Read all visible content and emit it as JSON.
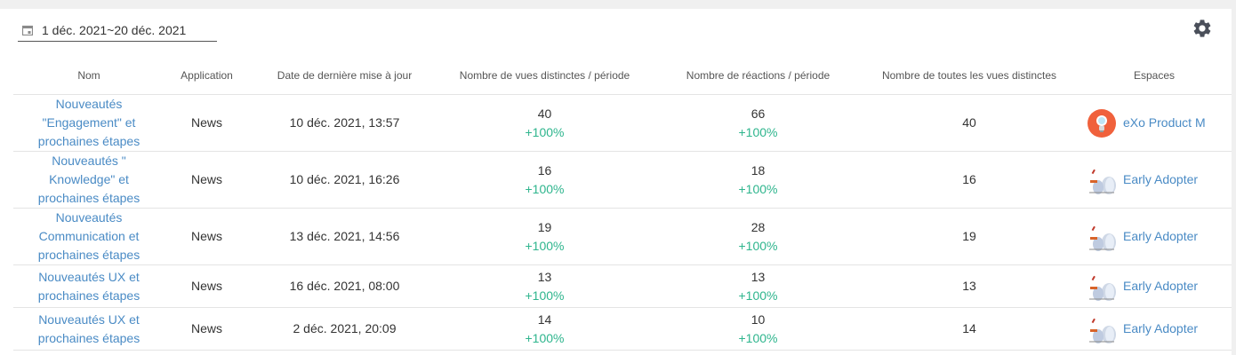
{
  "date_range": "1 déc. 2021~20 déc. 2021",
  "colors": {
    "link": "#4a8bc5",
    "positive": "#2eb58d",
    "avatar_orange": "#f0613c"
  },
  "icons": {
    "date": "calendar-icon",
    "settings": "gear-icon",
    "space_product": "lightbulb-avatar-icon",
    "space_early": "early-adopters-avatar-icon"
  },
  "columns": [
    "Nom",
    "Application",
    "Date de dernière mise à jour",
    "Nombre de vues distinctes / période",
    "Nombre de réactions / période",
    "Nombre de toutes les vues distinctes",
    "Espaces"
  ],
  "rows": [
    {
      "name": "Nouveautés \"Engagement\" et prochaines étapes",
      "app": "News",
      "updated": "10 déc. 2021, 13:57",
      "views": "40",
      "views_delta": "+100%",
      "reactions": "66",
      "reactions_delta": "+100%",
      "total_views": "40",
      "space": "eXo Product M",
      "space_icon": "lightbulb-avatar-icon"
    },
    {
      "name": "Nouveautés \" Knowledge\" et prochaines étapes",
      "app": "News",
      "updated": "10 déc. 2021, 16:26",
      "views": "16",
      "views_delta": "+100%",
      "reactions": "18",
      "reactions_delta": "+100%",
      "total_views": "16",
      "space": "Early Adopter",
      "space_icon": "early-adopters-avatar-icon"
    },
    {
      "name": "Nouveautés Communication et prochaines étapes",
      "app": "News",
      "updated": "13 déc. 2021, 14:56",
      "views": "19",
      "views_delta": "+100%",
      "reactions": "28",
      "reactions_delta": "+100%",
      "total_views": "19",
      "space": "Early Adopter",
      "space_icon": "early-adopters-avatar-icon"
    },
    {
      "name": "Nouveautés UX et prochaines étapes",
      "app": "News",
      "updated": "16 déc. 2021, 08:00",
      "views": "13",
      "views_delta": "+100%",
      "reactions": "13",
      "reactions_delta": "+100%",
      "total_views": "13",
      "space": "Early Adopter",
      "space_icon": "early-adopters-avatar-icon"
    },
    {
      "name": "Nouveautés UX et prochaines étapes",
      "app": "News",
      "updated": "2 déc. 2021, 20:09",
      "views": "14",
      "views_delta": "+100%",
      "reactions": "10",
      "reactions_delta": "+100%",
      "total_views": "14",
      "space": "Early Adopter",
      "space_icon": "early-adopters-avatar-icon"
    }
  ]
}
